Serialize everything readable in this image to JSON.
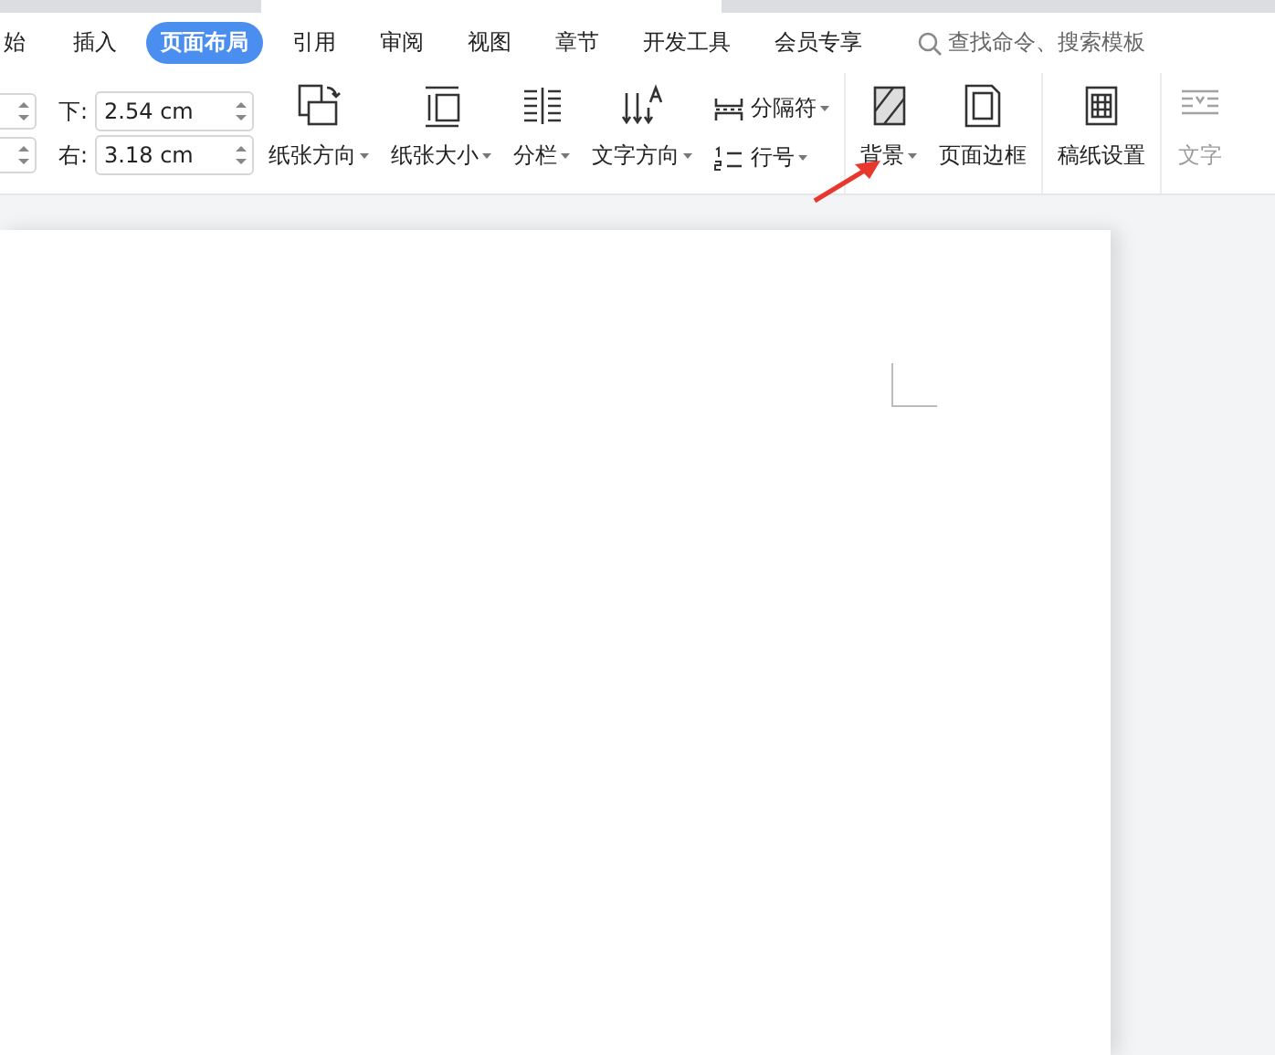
{
  "tabs": [
    {
      "label": "始",
      "selected": false
    },
    {
      "label": "插入",
      "selected": false
    },
    {
      "label": "页面布局",
      "selected": true
    },
    {
      "label": "引用",
      "selected": false
    },
    {
      "label": "审阅",
      "selected": false
    },
    {
      "label": "视图",
      "selected": false
    },
    {
      "label": "章节",
      "selected": false
    },
    {
      "label": "开发工具",
      "selected": false
    },
    {
      "label": "会员专享",
      "selected": false
    }
  ],
  "search": {
    "placeholder": "查找命令、搜索模板"
  },
  "margins": [
    {
      "label": "下:",
      "value": "2.54 cm"
    },
    {
      "label": "右:",
      "value": "3.18 cm"
    }
  ],
  "tool_groups": [
    {
      "tools": [
        {
          "kind": "large",
          "label": "纸张方向",
          "dropdown": true,
          "disabled": false
        },
        {
          "kind": "large",
          "label": "纸张大小",
          "dropdown": true,
          "disabled": false
        },
        {
          "kind": "large",
          "label": "分栏",
          "dropdown": true,
          "disabled": false
        },
        {
          "kind": "large",
          "label": "文字方向",
          "dropdown": true,
          "disabled": false
        },
        {
          "kind": "small",
          "label": "分隔符",
          "dropdown": true,
          "disabled": false
        },
        {
          "kind": "small",
          "label": "行号",
          "dropdown": true,
          "disabled": false
        }
      ]
    },
    {
      "tools": [
        {
          "kind": "large",
          "label": "背景",
          "dropdown": true,
          "disabled": false
        },
        {
          "kind": "large",
          "label": "页面边框",
          "dropdown": false,
          "disabled": false
        }
      ]
    },
    {
      "tools": [
        {
          "kind": "large",
          "label": "稿纸设置",
          "dropdown": false,
          "disabled": false
        }
      ]
    },
    {
      "tools": [
        {
          "kind": "large",
          "label": "文字",
          "dropdown": false,
          "disabled": true
        }
      ]
    }
  ]
}
